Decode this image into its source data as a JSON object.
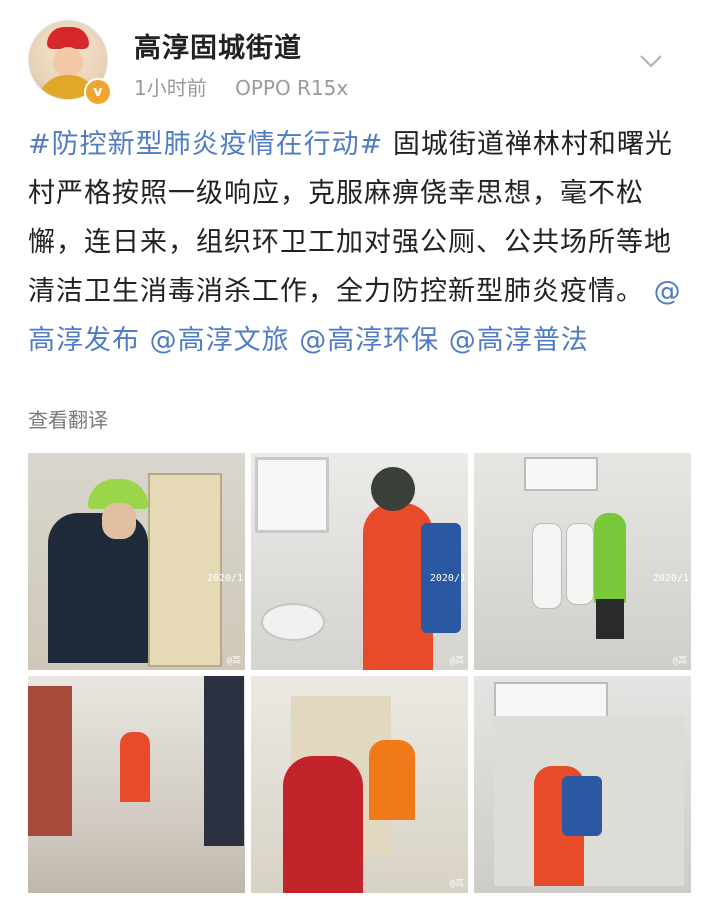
{
  "author": {
    "name": "高淳固城街道",
    "time": "1小时前",
    "device": "OPPO R15x",
    "avatar_icon": "avatar-opera-figure",
    "verified_badge": "v"
  },
  "post": {
    "hashtag": "#防控新型肺炎疫情在行动#",
    "body": " 固城街道禅林村和曙光村严格按照一级响应，克服麻痹侥幸思想，毫不松懈，连日来，组织环卫工加对强公厕、公共场所等地清洁卫生消毒消杀工作，全力防控新型肺炎疫情。",
    "mentions": [
      "@高淳发布",
      "@高淳文旅",
      "@高淳环保",
      "@高淳普法"
    ]
  },
  "translate_label": "查看翻译",
  "photos": [
    {
      "date": "2020/1",
      "stamp": "@高"
    },
    {
      "date": "2020/1",
      "stamp": "@高"
    },
    {
      "date": "2020/1",
      "stamp": "@高"
    },
    {
      "date": "",
      "stamp": ""
    },
    {
      "date": "",
      "stamp": "@高"
    },
    {
      "date": "",
      "stamp": ""
    }
  ],
  "colors": {
    "link": "#4f7cc4",
    "meta": "#9a9a9a",
    "worker_orange": "#e84b2a",
    "vest_green": "#7ec83a"
  }
}
